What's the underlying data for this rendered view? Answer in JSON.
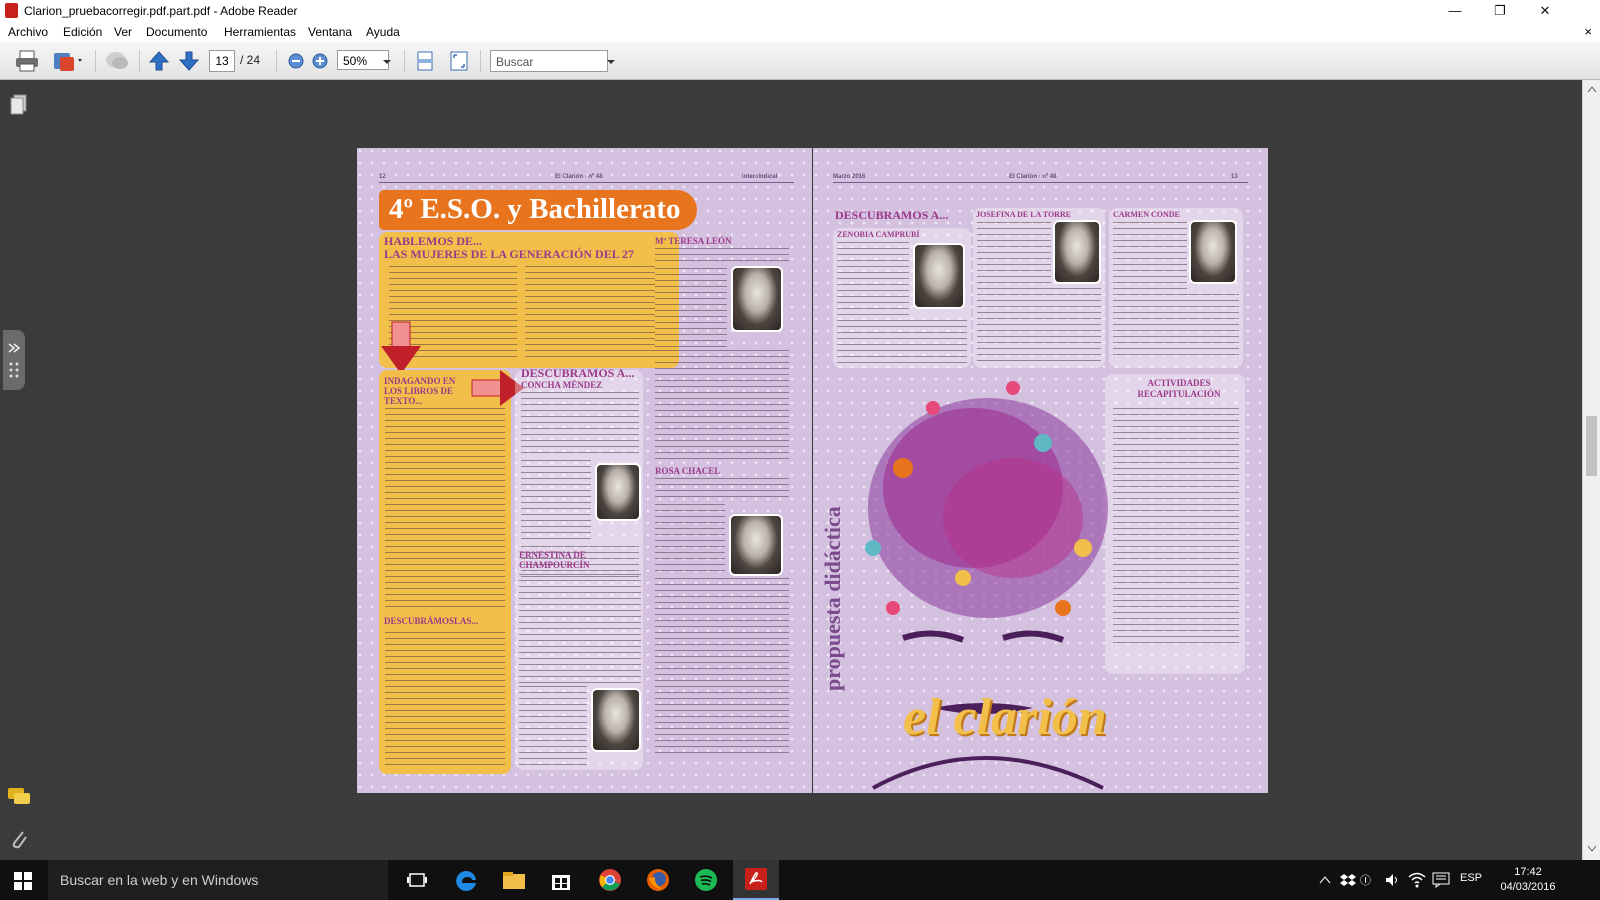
{
  "window": {
    "title": "Clarion_pruebacorregir.pdf.part.pdf - Adobe Reader",
    "minimize": "—",
    "maximize": "❐",
    "close": "✕"
  },
  "menu": {
    "items": [
      "Archivo",
      "Edición",
      "Ver",
      "Documento",
      "Herramientas",
      "Ventana",
      "Ayuda"
    ],
    "close": "×"
  },
  "toolbar": {
    "current_page": "13",
    "total_pages": "/ 24",
    "zoom": "50%",
    "search_placeholder": "Buscar"
  },
  "document": {
    "left_page": {
      "header_left": "12",
      "header_center": "El Clarión · nº 48",
      "header_right": "Intercindical",
      "banner": "4º E.S.O. y Bachillerato",
      "intro_heading_1": "HABLEMOS DE...",
      "intro_heading_2": "LAS MUJERES DE LA GENERACIÓN DEL 27",
      "indagando_heading": "INDAGANDO EN LOS LIBROS DE TEXTO...",
      "descubramos_heading": "DESCUBRAMOS A...",
      "concha_heading": "CONCHA MÉNDEZ",
      "descubramoslas_heading": "DESCUBRÁMOSLAS...",
      "teresa_heading": "Mª TERESA LEÓN",
      "rosa_heading": "ROSA CHACEL",
      "ernestina_heading": "ERNESTINA DE CHAMPOURCÍN"
    },
    "right_page": {
      "header_left": "Marzo 2016",
      "header_center": "El Clarión · nº 48",
      "header_right": "13",
      "descubramos_heading": "DESCUBRAMOS A...",
      "zenobia_heading": "ZENOBIA CAMPRUBÍ",
      "josefina_heading": "JOSEFINA DE LA TORRE",
      "carmen_heading": "CARMEN CONDE",
      "actividades_heading": "ACTIVIDADES RECAPITULACIÓN",
      "vertical_title": "propuesta didáctica",
      "logo": "el clarión"
    }
  },
  "taskbar": {
    "search_text": "Buscar en la web y en Windows",
    "language": "ESP",
    "time": "17:42",
    "date": "04/03/2016"
  },
  "colors": {
    "page_bg": "#d4c0df",
    "banner": "#e8741e",
    "heading": "#9b3a8a",
    "yellow_box": "#f2c04a",
    "arrow": "#c0202a"
  }
}
